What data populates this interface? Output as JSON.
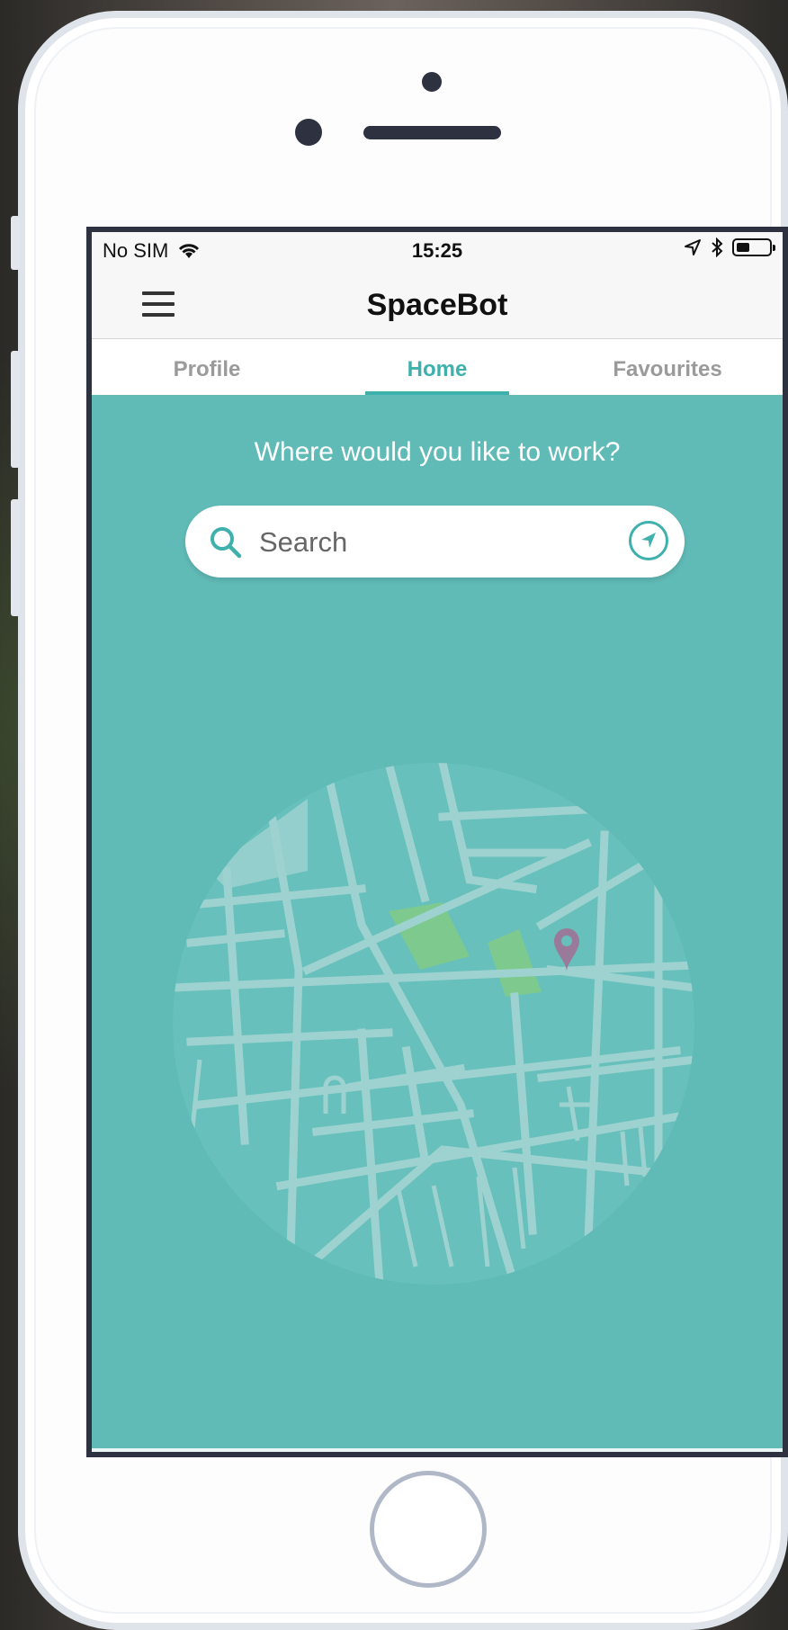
{
  "status_bar": {
    "carrier": "No SIM",
    "time": "15:25"
  },
  "nav": {
    "title": "SpaceBot"
  },
  "tabs": [
    {
      "label": "Profile",
      "active": false
    },
    {
      "label": "Home",
      "active": true
    },
    {
      "label": "Favourites",
      "active": false
    }
  ],
  "home": {
    "heading": "Where would you like to work?",
    "search": {
      "placeholder": "Search"
    }
  },
  "icons": [
    "menu-icon",
    "wifi-icon",
    "location-arrow-icon",
    "bluetooth-icon",
    "battery-icon",
    "search-icon",
    "locate-icon",
    "map-pin-icon"
  ],
  "colors": {
    "accent": "#3fb1ad",
    "background": "#60bbb7",
    "map_park": "#7ec98e",
    "map_pin": "#9a7a9a"
  }
}
